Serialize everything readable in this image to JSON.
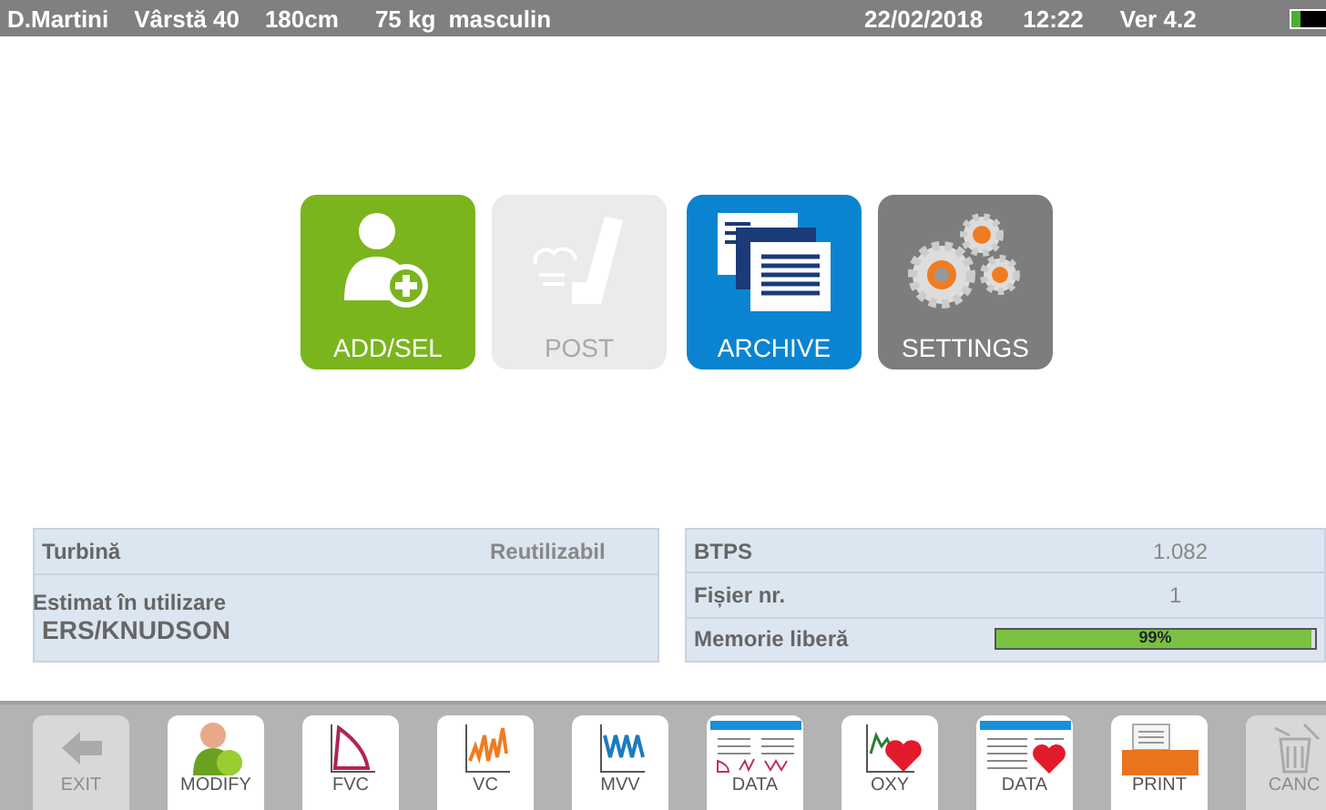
{
  "header": {
    "patient": "D.Martini",
    "age": "Vârstă 40",
    "height": "180cm",
    "weight": "75 kg",
    "sex": "masculin",
    "date": "22/02/2018",
    "time": "12:22",
    "version": "Ver 4.2"
  },
  "tiles": [
    {
      "kind": "add",
      "label": "ADD/SEL",
      "disabled": false
    },
    {
      "kind": "post",
      "label": "POST",
      "disabled": true
    },
    {
      "kind": "archive",
      "label": "ARCHIVE",
      "disabled": false
    },
    {
      "kind": "settings",
      "label": "SETTINGS",
      "disabled": false
    }
  ],
  "left_panel": {
    "turbine_label": "Turbină",
    "turbine_value": "Reutilizabil",
    "predicted_label": "Estimat în utilizare",
    "predicted_value": "ERS/KNUDSON"
  },
  "right_panel": {
    "btps_label": "BTPS",
    "btps_value": "1.082",
    "file_label": "Fișier nr.",
    "file_value": "1",
    "memory": {
      "label": "Memorie liberă",
      "level": 0.99,
      "reading": "99%"
    }
  },
  "toolbar": [
    {
      "kind": "exit",
      "label": "EXIT",
      "disabled": true
    },
    {
      "kind": "modify",
      "label": "MODIFY",
      "disabled": false
    },
    {
      "kind": "fvc",
      "label": "FVC",
      "disabled": false
    },
    {
      "kind": "vc",
      "label": "VC",
      "disabled": false
    },
    {
      "kind": "mvv",
      "label": "MVV",
      "disabled": false
    },
    {
      "kind": "data",
      "label": "DATA",
      "disabled": false
    },
    {
      "kind": "oxy",
      "label": "OXY",
      "disabled": false
    },
    {
      "kind": "dataheart",
      "label": "DATA",
      "disabled": false
    },
    {
      "kind": "print",
      "label": "PRINT",
      "disabled": false
    },
    {
      "kind": "canc",
      "label": "CANC",
      "disabled": true
    }
  ]
}
